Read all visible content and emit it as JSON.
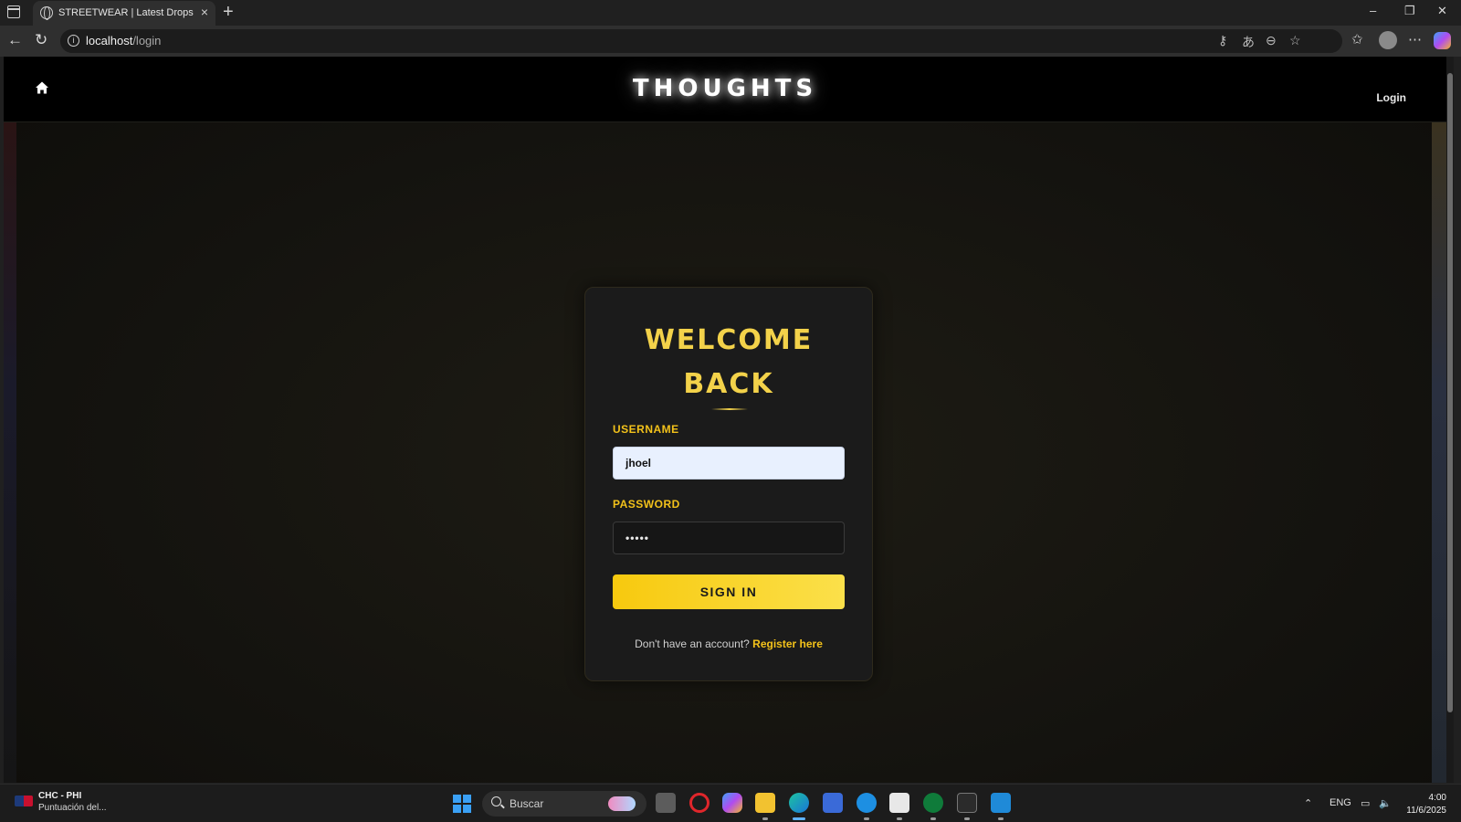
{
  "browser": {
    "tab_title": "STREETWEAR | Latest Drops",
    "tab_close": "×",
    "new_tab": "+",
    "url_host": "localhost",
    "url_path": "/login",
    "win_minimize": "–",
    "win_restore": "❐",
    "win_close": "✕"
  },
  "site": {
    "brand": "THOUGHTS",
    "nav_login": "Login"
  },
  "login_form": {
    "title_line1": "WELCOME",
    "title_line2": "BACK",
    "username_label": "USERNAME",
    "username_value": "jhoel",
    "password_label": "PASSWORD",
    "password_value": "•••••",
    "submit_label": "SIGN IN",
    "register_prompt": "Don't have an account?",
    "register_link": "Register here"
  },
  "taskbar": {
    "weather_title": "CHC - PHI",
    "weather_subtitle": "Puntuación del...",
    "search_placeholder": "Buscar",
    "language": "ENG",
    "time": "4:00",
    "date": "11/6/2025"
  },
  "colors": {
    "accent": "#f3d24a",
    "button": "#f7c90e",
    "page_bg": "#141410",
    "card_bg": "#1b1b1b"
  }
}
